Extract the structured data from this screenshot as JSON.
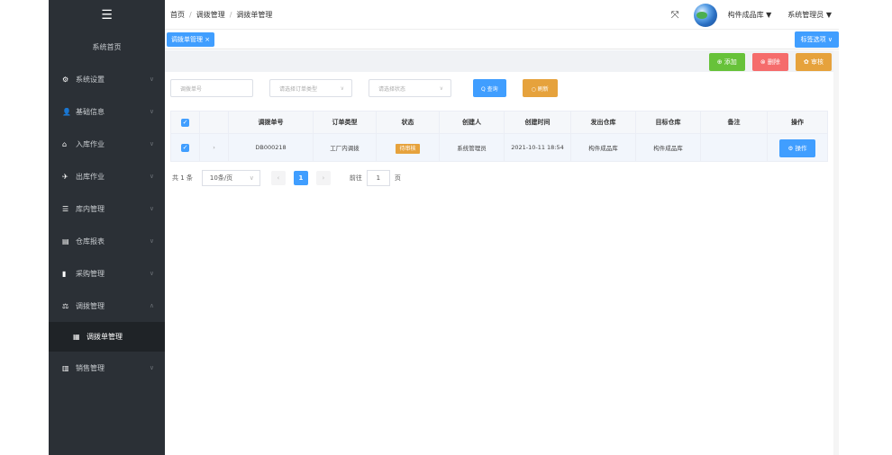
{
  "sidebar": {
    "logo_icon": "menu-icon",
    "home": "系统首页",
    "items": [
      {
        "label": "系统设置",
        "icon": "⚙"
      },
      {
        "label": "基础信息",
        "icon": "👤"
      },
      {
        "label": "入库作业",
        "icon": "⌂"
      },
      {
        "label": "出库作业",
        "icon": "✈"
      },
      {
        "label": "库内管理",
        "icon": "☰"
      },
      {
        "label": "仓库报表",
        "icon": "▤"
      },
      {
        "label": "采购管理",
        "icon": "▮"
      },
      {
        "label": "调拨管理",
        "icon": "⚖"
      }
    ],
    "sub_item": "调拨单管理",
    "last_item": {
      "label": "销售管理",
      "icon": "▥"
    }
  },
  "header": {
    "breadcrumb": [
      "首页",
      "调拨管理",
      "调拨单管理"
    ],
    "warehouse": "构件成品库 ▼",
    "user": "系统管理员 ▼"
  },
  "tags": {
    "active": "调拨单管理 ×",
    "options": "标签选项 ∨"
  },
  "toolbar": {
    "add": "⊕ 添加",
    "delete": "⊗ 删除",
    "audit": "✿ 审核"
  },
  "filters": {
    "order_no_placeholder": "调拨单号",
    "order_type_placeholder": "请选择订单类型",
    "status_placeholder": "请选择状态",
    "search": "Q 查询",
    "refresh": "○ 刷新"
  },
  "table": {
    "headers": [
      "调拨单号",
      "订单类型",
      "状态",
      "创建人",
      "创建时间",
      "发出仓库",
      "目标仓库",
      "备注",
      "操作"
    ],
    "rows": [
      {
        "order_no": "DB000218",
        "type": "工厂内调拨",
        "status": "待审核",
        "creator": "系统管理员",
        "created": "2021-10-11 18:54",
        "from": "构件成品库",
        "to": "构件成品库",
        "remark": "",
        "action": "⚙ 操作"
      }
    ]
  },
  "pager": {
    "total": "共 1 条",
    "page_size": "10条/页",
    "current": "1",
    "goto_label": "前往",
    "goto_value": "1",
    "page_unit": "页"
  },
  "colors": {
    "primary": "#409eff",
    "success": "#67c23a",
    "danger": "#f56c6c",
    "warning": "#e6a23c",
    "sidebar": "#2b3036"
  }
}
